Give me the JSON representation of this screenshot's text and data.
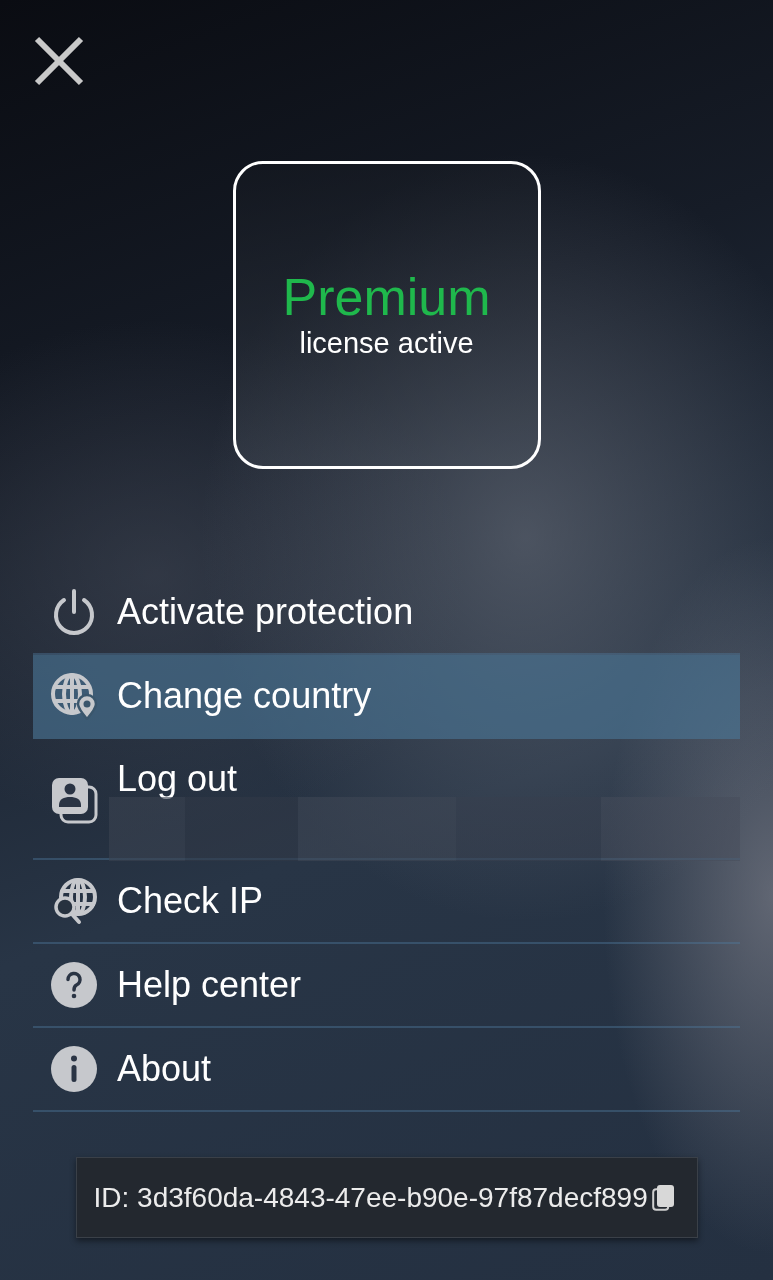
{
  "license": {
    "tier": "Premium",
    "status": "license active"
  },
  "menu": [
    {
      "label": "Activate protection",
      "selected": false,
      "redacted": false
    },
    {
      "label": "Change country",
      "selected": true,
      "redacted": false
    },
    {
      "label": "Log out",
      "selected": false,
      "redacted": true
    },
    {
      "label": "Check IP",
      "selected": false,
      "redacted": false
    },
    {
      "label": "Help center",
      "selected": false,
      "redacted": false
    },
    {
      "label": "About",
      "selected": false,
      "redacted": false
    }
  ],
  "device_id": {
    "text": "ID: 3d3f60da-4843-47ee-b90e-97f87decf899"
  }
}
